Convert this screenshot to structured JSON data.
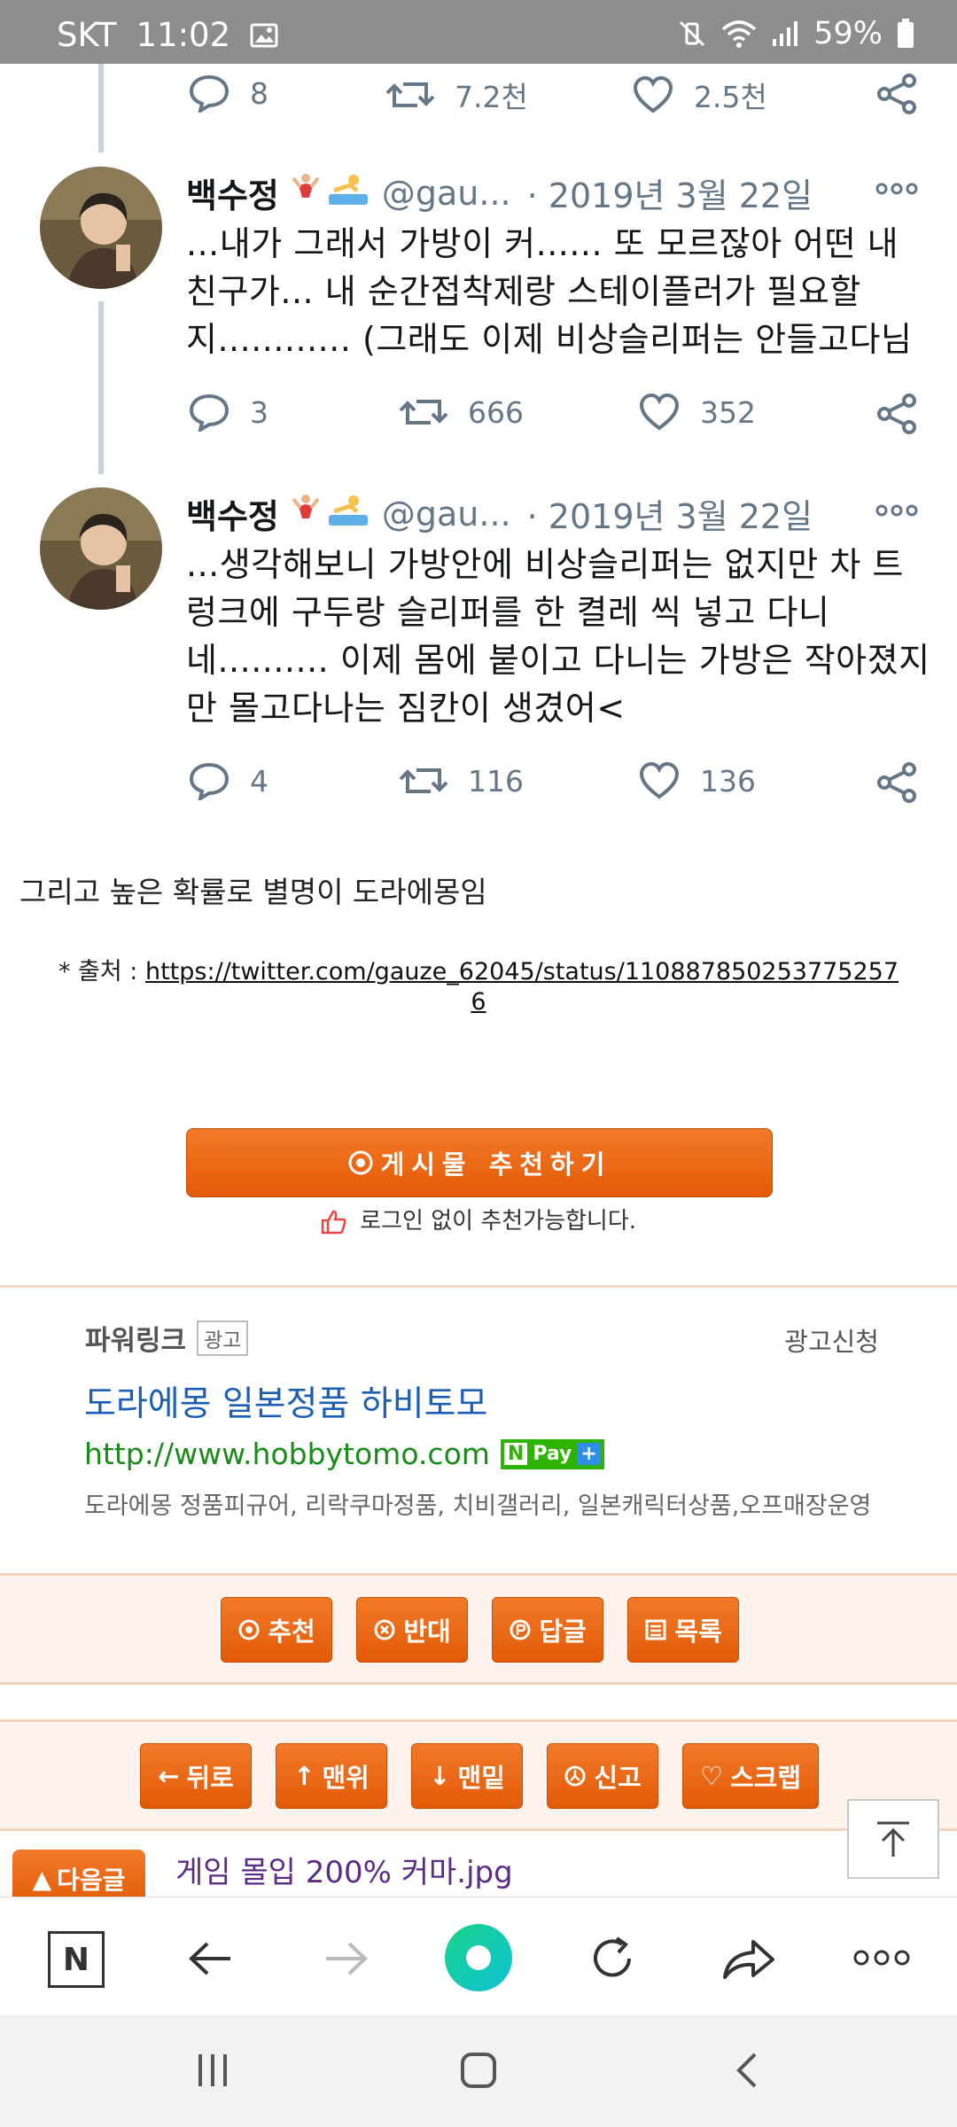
{
  "status_bar": {
    "carrier": "SKT",
    "time": "11:02",
    "battery": "59%"
  },
  "top_actions": {
    "replies": "8",
    "retweets": "7.2천",
    "likes": "2.5천"
  },
  "tweets": [
    {
      "name": "백수정",
      "handle": "@gau...",
      "date": "· 2019년 3월 22일",
      "text": "...내가 그래서 가방이 커...... 또 모르잖아 어떤 내 친구가... 내 순간접착제랑 스테이플러가 필요할지............ (그래도 이제 비상슬리퍼는 안들고다님",
      "replies": "3",
      "retweets": "666",
      "likes": "352"
    },
    {
      "name": "백수정",
      "handle": "@gau...",
      "date": "· 2019년 3월 22일",
      "text": "...생각해보니 가방안에 비상슬리퍼는 없지만 차 트렁크에 구두랑 슬리퍼를 한 켤레 씩 넣고 다니네.......... 이제 몸에 붙이고 다니는 가방은 작아졌지만 몰고다나는 짐칸이 생겼어<",
      "replies": "4",
      "retweets": "116",
      "likes": "136"
    }
  ],
  "body_text": "그리고 높은 확률로 별명이 도라에몽임",
  "source": {
    "prefix": "* 출처 : ",
    "url_line1": "https://twitter.com/gauze_62045/status/110887850253775257",
    "url_line2": "6"
  },
  "recommend": {
    "button_label": "게시물  추천하기",
    "note": "로그인 없이 추천가능합니다."
  },
  "ad": {
    "powerlink": "파워링크",
    "ad_badge": "광고",
    "apply": "광고신청",
    "title": "도라에몽 일본정품 하비토모",
    "url": "http://www.hobbytomo.com",
    "npay": "Pay",
    "description": "도라에몽 정품피규어, 리락쿠마정품, 치비갤러리, 일본캐릭터상품,오프매장운영"
  },
  "vote_buttons": [
    "추천",
    "반대",
    "답글",
    "목록"
  ],
  "nav_buttons": [
    "뒤로",
    "맨위",
    "맨밑",
    "신고",
    "스크랩"
  ],
  "next_post": {
    "button": "다음글",
    "title": "게임 몰입 200% 커마.jpg"
  }
}
